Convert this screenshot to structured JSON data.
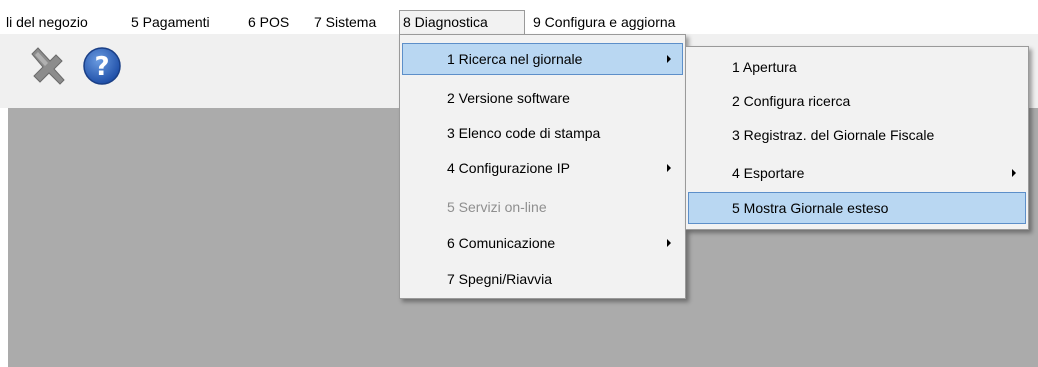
{
  "menubar": {
    "items": [
      {
        "label": "li del negozio"
      },
      {
        "label": "5 Pagamenti"
      },
      {
        "label": "6 POS"
      },
      {
        "label": "7 Sistema"
      },
      {
        "label": "8 Diagnostica"
      },
      {
        "label": "9 Configura e aggiorna"
      }
    ]
  },
  "toolbar": {
    "tools_icon": "wrench-screwdriver-icon",
    "help_icon": "question-mark-icon"
  },
  "diagnostica_menu": {
    "items": [
      {
        "label": "1 Ricerca nel giornale",
        "submenu": true,
        "highlighted": true,
        "enabled": true
      },
      {
        "label": "2 Versione software",
        "submenu": false,
        "highlighted": false,
        "enabled": true
      },
      {
        "label": "3 Elenco code di stampa",
        "submenu": false,
        "highlighted": false,
        "enabled": true
      },
      {
        "label": "4 Configurazione IP",
        "submenu": true,
        "highlighted": false,
        "enabled": true
      },
      {
        "label": "5 Servizi on-line",
        "submenu": false,
        "highlighted": false,
        "enabled": false
      },
      {
        "label": "6 Comunicazione",
        "submenu": true,
        "highlighted": false,
        "enabled": true
      },
      {
        "label": "7 Spegni/Riavvia",
        "submenu": false,
        "highlighted": false,
        "enabled": true
      }
    ]
  },
  "ricerca_submenu": {
    "items": [
      {
        "label": "1 Apertura",
        "submenu": false,
        "highlighted": false
      },
      {
        "label": "2 Configura ricerca",
        "submenu": false,
        "highlighted": false
      },
      {
        "label": "3 Registraz. del Giornale Fiscale",
        "submenu": false,
        "highlighted": false
      },
      {
        "label": "4 Esportare",
        "submenu": true,
        "highlighted": false
      },
      {
        "label": "5 Mostra Giornale esteso",
        "submenu": false,
        "highlighted": true
      }
    ]
  },
  "colors": {
    "menu_background": "#f2f2f2",
    "highlight": "#b9d7f2",
    "highlight_border": "#5d8fc9",
    "workspace": "#ababab",
    "toolbar": "#f0f0f0"
  }
}
